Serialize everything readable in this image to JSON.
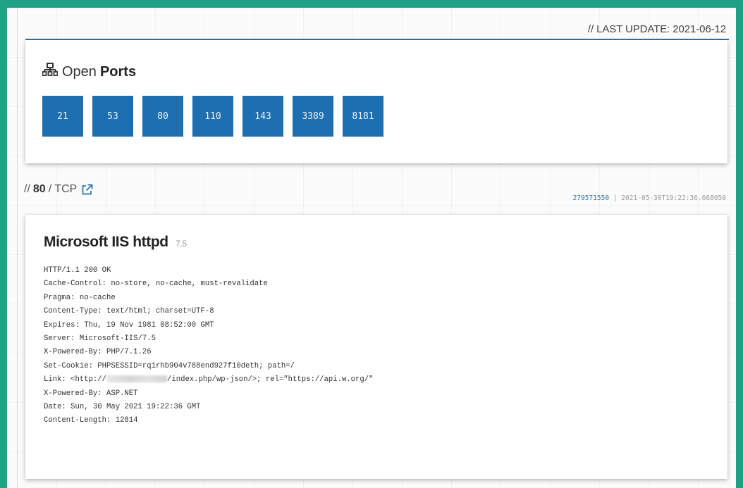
{
  "last_update": "// LAST UPDATE: 2021-06-12",
  "ports_section": {
    "title_light": "Open",
    "title_bold": "Ports",
    "ports": [
      "21",
      "53",
      "80",
      "110",
      "143",
      "3389",
      "8181"
    ]
  },
  "port_detail": {
    "prefix": "//",
    "port": "80",
    "protocol": "/ TCP",
    "hash": "279571550",
    "separator": "|",
    "timestamp": "2021-05-30T19:22:36.668050",
    "service_name": "Microsoft IIS httpd",
    "service_version": "7.5",
    "banner_lines": [
      "HTTP/1.1 200 OK",
      "Cache-Control: no-store, no-cache, must-revalidate",
      "Pragma: no-cache",
      "Content-Type: text/html; charset=UTF-8",
      "Expires: Thu, 19 Nov 1981 08:52:00 GMT",
      "Server: Microsoft-IIS/7.5",
      "X-Powered-By: PHP/7.1.26",
      "Set-Cookie: PHPSESSID=rq1rhb904v788end927f10deth; path=/",
      "Link: <http://",
      "X-Powered-By: ASP.NET",
      "Date: Sun, 30 May 2021 19:22:36 GMT",
      "Content-Length: 12814"
    ],
    "link_suffix": "/index.php/wp-json/>; rel=\"https://api.w.org/\""
  },
  "colors": {
    "accent_blue": "#1d6fb0",
    "frame_green": "#1fa184"
  },
  "icons": [
    "network-icon",
    "external-link-icon"
  ]
}
